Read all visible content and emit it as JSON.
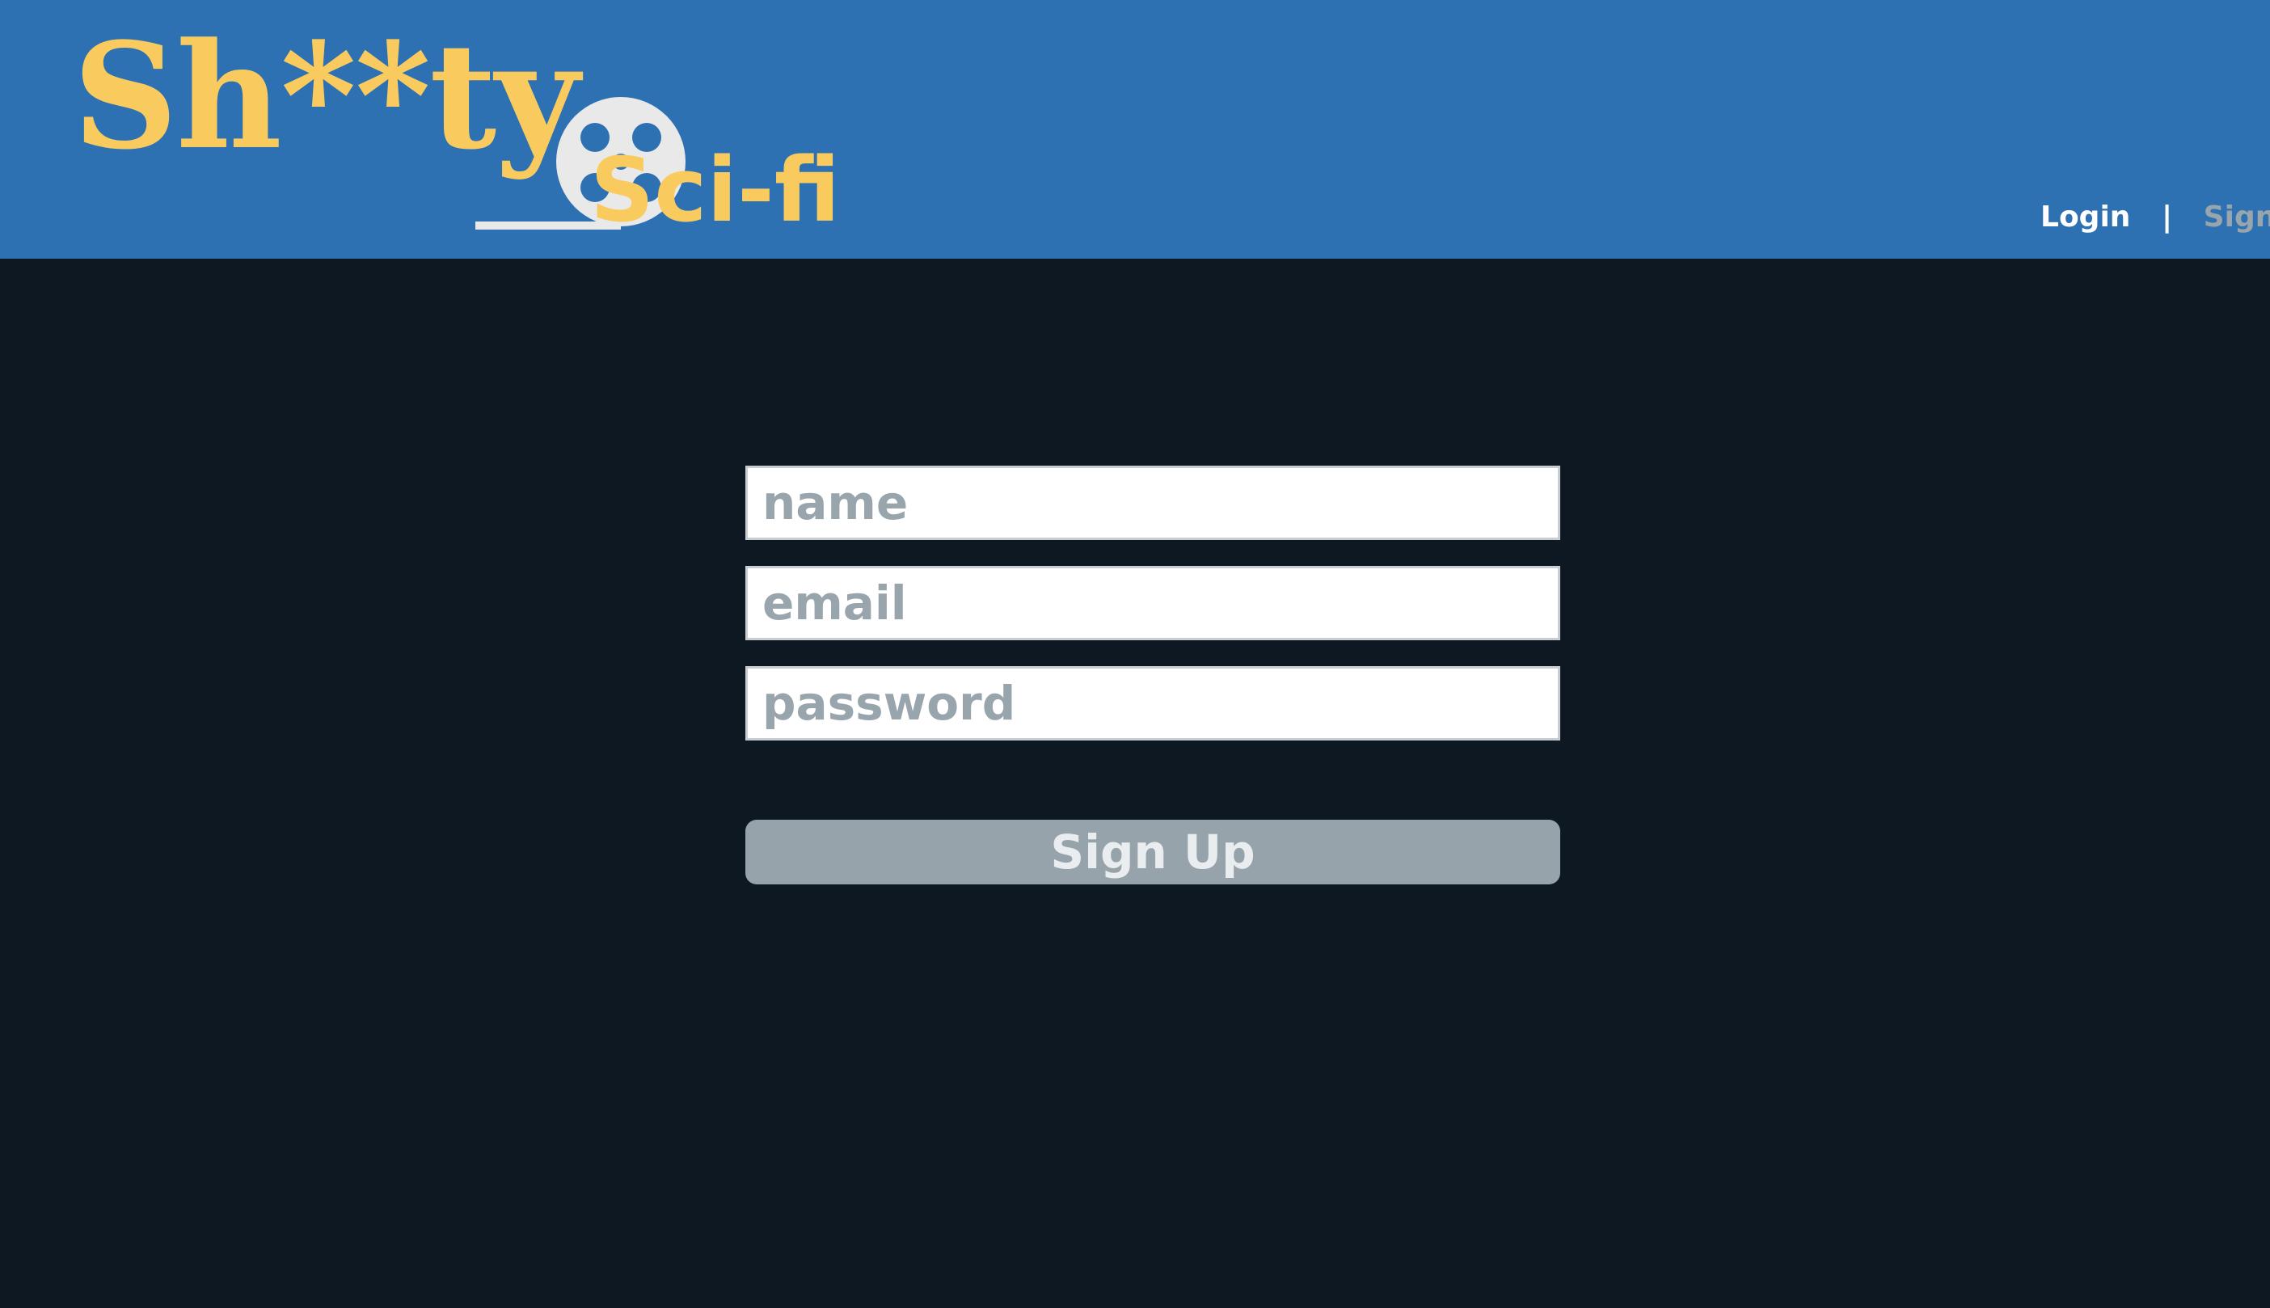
{
  "brand": {
    "title_top": "Sh**ty",
    "title_bottom": "Sci-fi",
    "colors": {
      "logo_yellow": "#f9cb5e",
      "reel_white": "#e9e9ea"
    }
  },
  "header": {
    "background": "#2e71b3",
    "nav": {
      "login_label": "Login",
      "separator": "|",
      "signup_label": "Sign Up"
    }
  },
  "signup_form": {
    "fields": {
      "name_placeholder": "name",
      "email_placeholder": "email",
      "password_placeholder": "password"
    },
    "submit_label": "Sign Up"
  },
  "page": {
    "background": "#0d1823"
  }
}
